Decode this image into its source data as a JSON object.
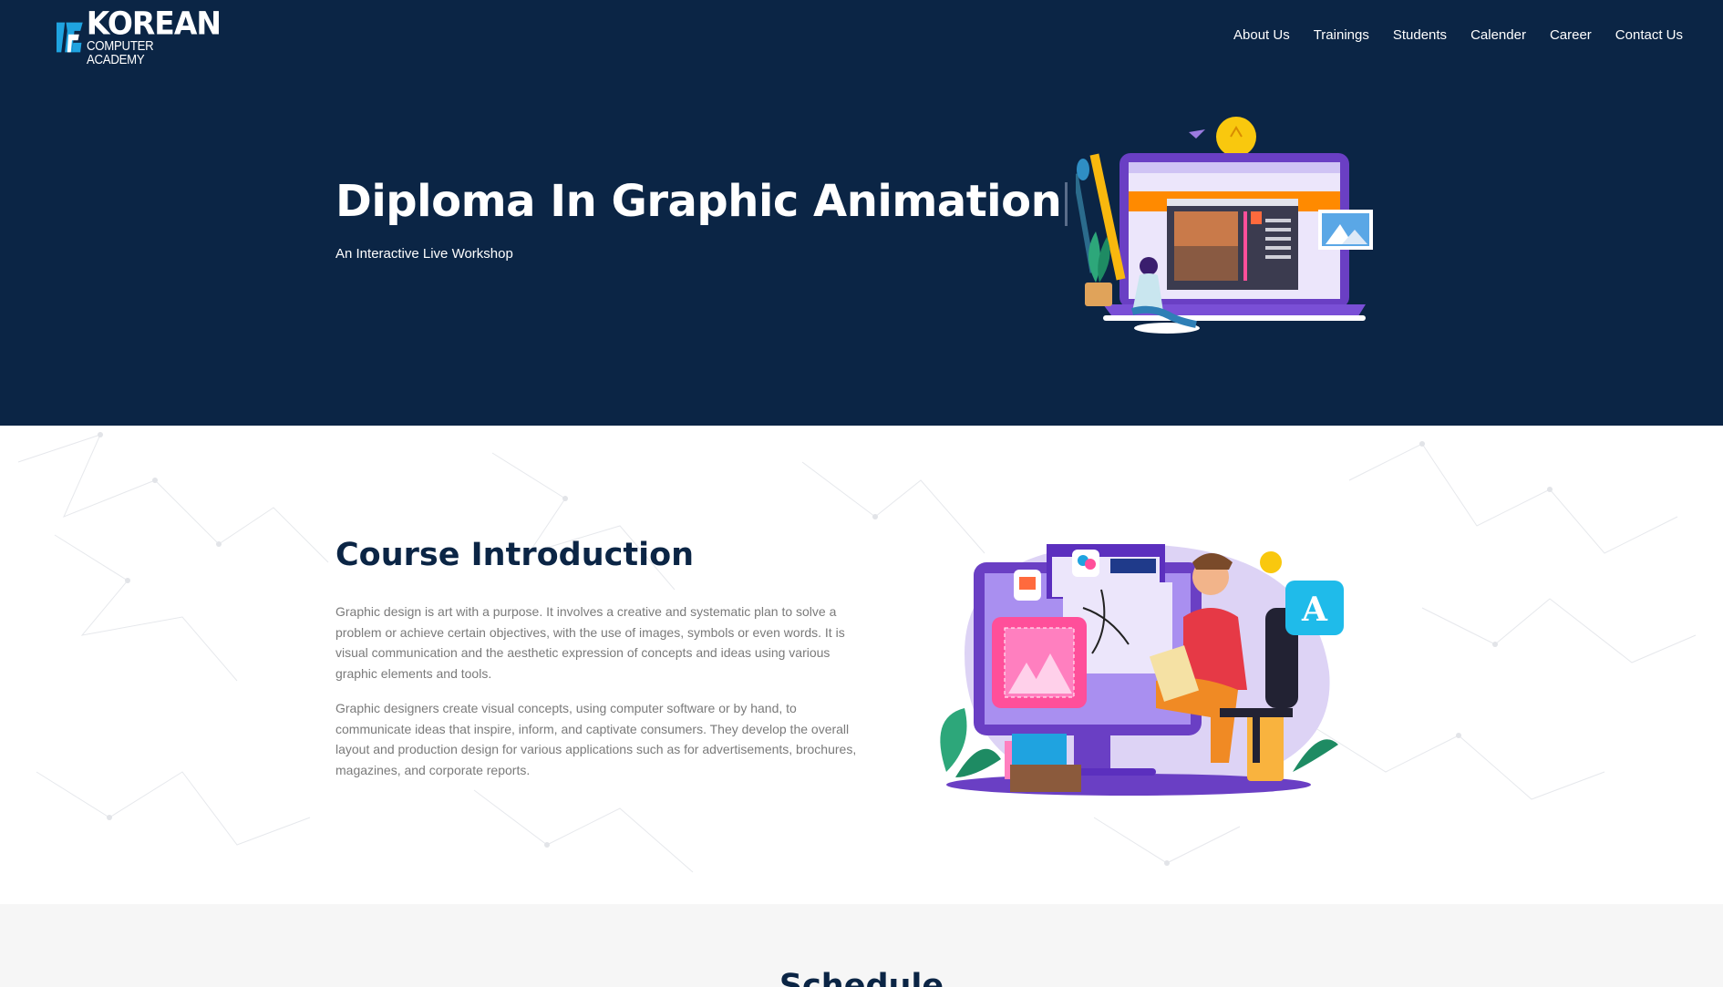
{
  "brand": {
    "line1": "KOREAN",
    "line2": "COMPUTER ACADEMY"
  },
  "nav": {
    "items": [
      "About Us",
      "Trainings",
      "Students",
      "Calender",
      "Career",
      "Contact Us"
    ]
  },
  "hero": {
    "title": "Diploma In Graphic Animation",
    "subtitle": "An Interactive Live Workshop",
    "illustration_icon": "designer-laptop-illustration"
  },
  "intro": {
    "title": "Course Introduction",
    "paragraphs": [
      "Graphic design is art with a purpose. It involves a creative and systematic plan to solve a problem or achieve certain objectives, with the use of images, symbols or even words. It is visual communication and the aesthetic expression of concepts and ideas using various graphic elements and tools.",
      "Graphic designers create visual concepts, using computer software or by hand, to communicate ideas that inspire, inform, and captivate consumers. They develop the overall layout and production design for various applications such as for advertisements, brochures, magazines, and corporate reports."
    ],
    "illustration_icon": "graphic-designer-illustration"
  },
  "schedule": {
    "title": "Schedule"
  },
  "colors": {
    "navy": "#0b2545",
    "body_text": "#7a7a7a",
    "accent_blue": "#1fa3e0"
  }
}
